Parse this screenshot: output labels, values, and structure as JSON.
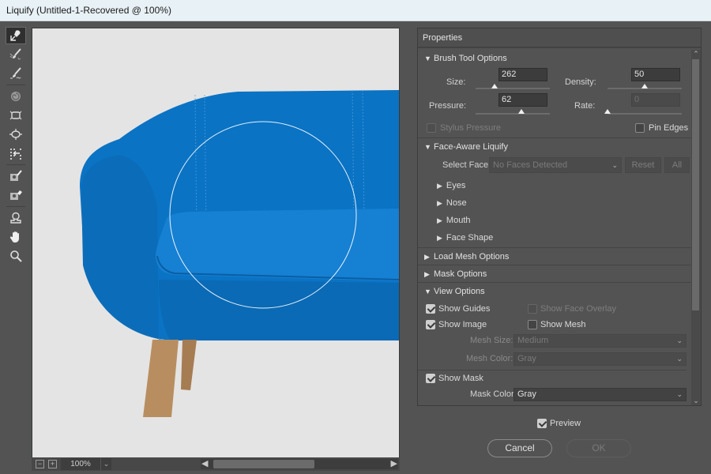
{
  "window": {
    "title": "Liquify (Untitled-1-Recovered @ 100%)"
  },
  "tools": [
    {
      "name": "forward-warp-tool",
      "active": true
    },
    {
      "name": "reconstruct-tool"
    },
    {
      "name": "smooth-tool"
    },
    {
      "name": "twirl-clockwise-tool"
    },
    {
      "name": "pucker-tool"
    },
    {
      "name": "bloat-tool"
    },
    {
      "name": "push-left-tool"
    },
    {
      "name": "freeze-mask-tool"
    },
    {
      "name": "thaw-mask-tool"
    },
    {
      "name": "face-tool"
    },
    {
      "name": "hand-tool"
    },
    {
      "name": "zoom-tool"
    }
  ],
  "canvas": {
    "zoom": "100%",
    "colors": {
      "background": "#e5e4e4",
      "sofa": "#0a73c4",
      "legs": "#b48a5c",
      "brush_ring": "#ffffff"
    }
  },
  "panel": {
    "title": "Properties",
    "brush": {
      "title": "Brush Tool Options",
      "size_label": "Size:",
      "size": "262",
      "size_fraction": 0.26,
      "density_label": "Density:",
      "density": "50",
      "density_fraction": 0.5,
      "pressure_label": "Pressure:",
      "pressure": "62",
      "pressure_fraction": 0.62,
      "rate_label": "Rate:",
      "rate": "0",
      "rate_fraction": 0.0,
      "stylus_label": "Stylus Pressure",
      "stylus_checked": false,
      "pin_label": "Pin Edges",
      "pin_checked": false
    },
    "face": {
      "title": "Face-Aware Liquify",
      "select_label": "Select Face:",
      "select_value": "No Faces Detected",
      "reset_label": "Reset",
      "all_label": "All",
      "subsections": [
        "Eyes",
        "Nose",
        "Mouth",
        "Face Shape"
      ]
    },
    "load_mesh": {
      "title": "Load Mesh Options"
    },
    "mask": {
      "title": "Mask Options"
    },
    "view": {
      "title": "View Options",
      "show_guides": "Show Guides",
      "show_guides_checked": true,
      "show_face_overlay": "Show Face Overlay",
      "show_face_overlay_checked": false,
      "show_image": "Show Image",
      "show_image_checked": true,
      "show_mesh": "Show Mesh",
      "show_mesh_checked": false,
      "mesh_size_label": "Mesh Size:",
      "mesh_size": "Medium",
      "mesh_color_label": "Mesh Color:",
      "mesh_color": "Gray",
      "show_mask": "Show Mask",
      "show_mask_checked": true,
      "mask_color_label": "Mask Color:",
      "mask_color": "Gray"
    }
  },
  "footer": {
    "preview_label": "Preview",
    "preview_checked": true,
    "cancel_label": "Cancel",
    "ok_label": "OK"
  }
}
